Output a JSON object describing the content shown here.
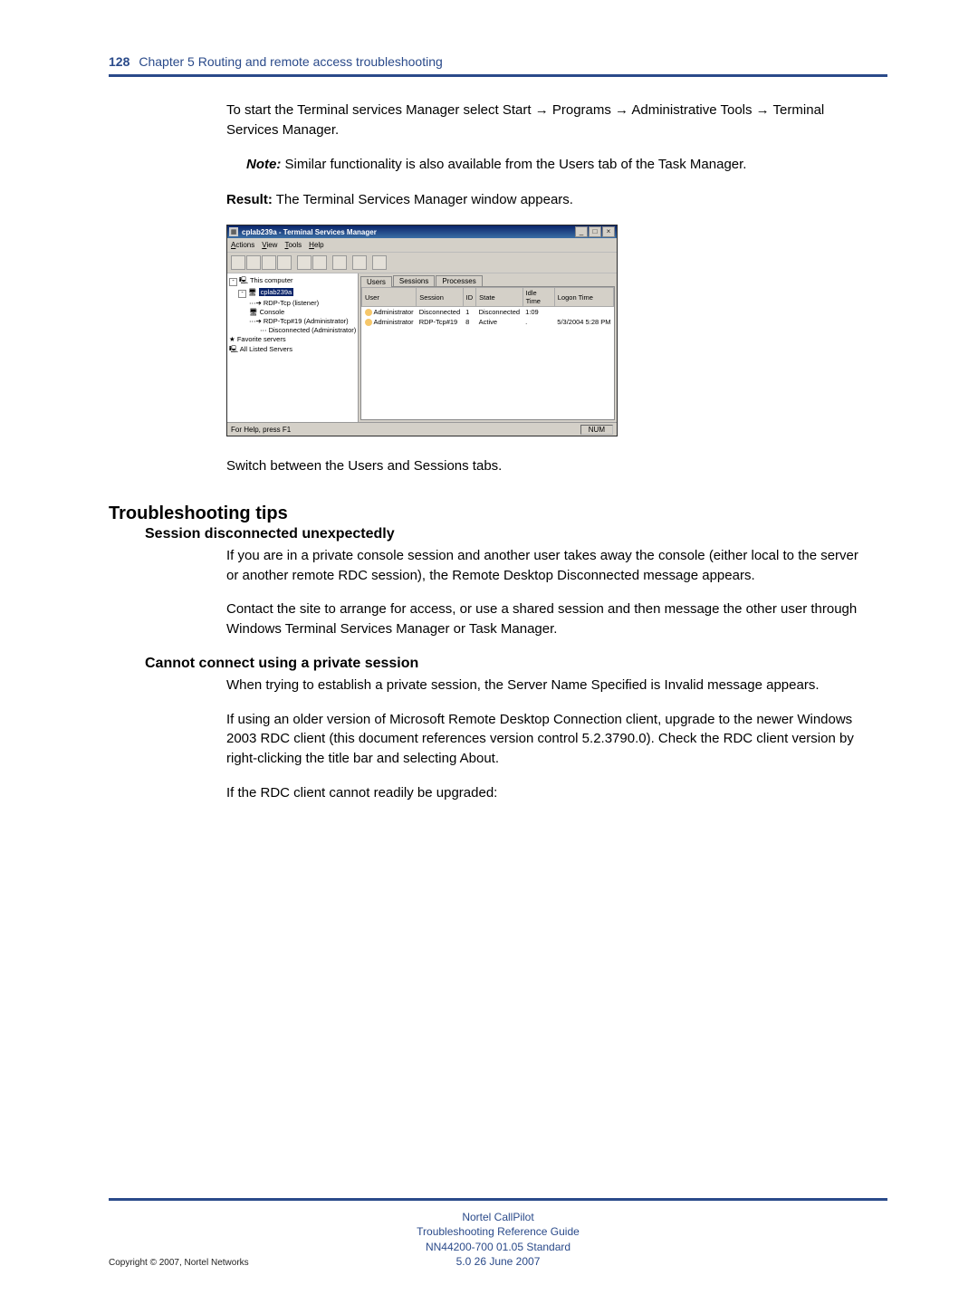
{
  "header": {
    "page_number": "128",
    "chapter": "Chapter 5  Routing and remote access troubleshooting"
  },
  "body": {
    "para1": "To start the Terminal services Manager select Start → Programs → Administrative Tools → Terminal Services Manager.",
    "note_label": "Note:",
    "note_text": " Similar functionality is also available from the Users tab of the Task Manager.",
    "result_label": "Result:",
    "result_text": " The Terminal Services Manager window appears.",
    "post_screenshot": "Switch between the Users and Sessions tabs."
  },
  "screenshot": {
    "title": "cplab239a - Terminal Services Manager",
    "menus": [
      "Actions",
      "View",
      "Tools",
      "Help"
    ],
    "tree": {
      "root": "This computer",
      "server": "cplab239a",
      "nodes": [
        "RDP-Tcp (listener)",
        "Console",
        "RDP-Tcp#19 (Administrator)",
        "Disconnected (Administrator)"
      ],
      "fav": "Favorite servers",
      "all": "All Listed Servers"
    },
    "tabs": [
      "Users",
      "Sessions",
      "Processes"
    ],
    "columns": [
      "User",
      "Session",
      "ID",
      "State",
      "Idle Time",
      "Logon Time"
    ],
    "rows": [
      {
        "user": "Administrator",
        "session": "Disconnected",
        "id": "1",
        "state": "Disconnected",
        "idle": "1:09",
        "logon": ""
      },
      {
        "user": "Administrator",
        "session": "RDP-Tcp#19",
        "id": "8",
        "state": "Active",
        "idle": ".",
        "logon": "5/3/2004 5:28 PM"
      }
    ],
    "status_left": "For Help, press F1",
    "status_right": "NUM"
  },
  "tips": {
    "heading": "Troubleshooting tips",
    "s1_title": "Session disconnected unexpectedly",
    "s1_p1": "If you are in a private console session and another user takes away the console (either local to the server or another remote RDC session), the Remote Desktop Disconnected message appears.",
    "s1_p2": "Contact the site to arrange for access, or use a shared session and then message the other user through Windows Terminal Services Manager or Task Manager.",
    "s2_title": "Cannot connect using a private session",
    "s2_p1": "When trying to establish a private session, the Server Name Specified is Invalid message appears.",
    "s2_p2": "If using an older version of Microsoft Remote Desktop Connection client, upgrade to the newer Windows 2003 RDC client (this document references version control 5.2.3790.0). Check the RDC client version by right-clicking the title bar and selecting About.",
    "s2_p3": "If the RDC client cannot readily be upgraded:"
  },
  "footer": {
    "line1": "Nortel CallPilot",
    "line2": "Troubleshooting Reference Guide",
    "line3": "NN44200-700   01.05   Standard",
    "line4": "5.0   26 June 2007",
    "copyright": "Copyright © 2007, Nortel Networks"
  }
}
